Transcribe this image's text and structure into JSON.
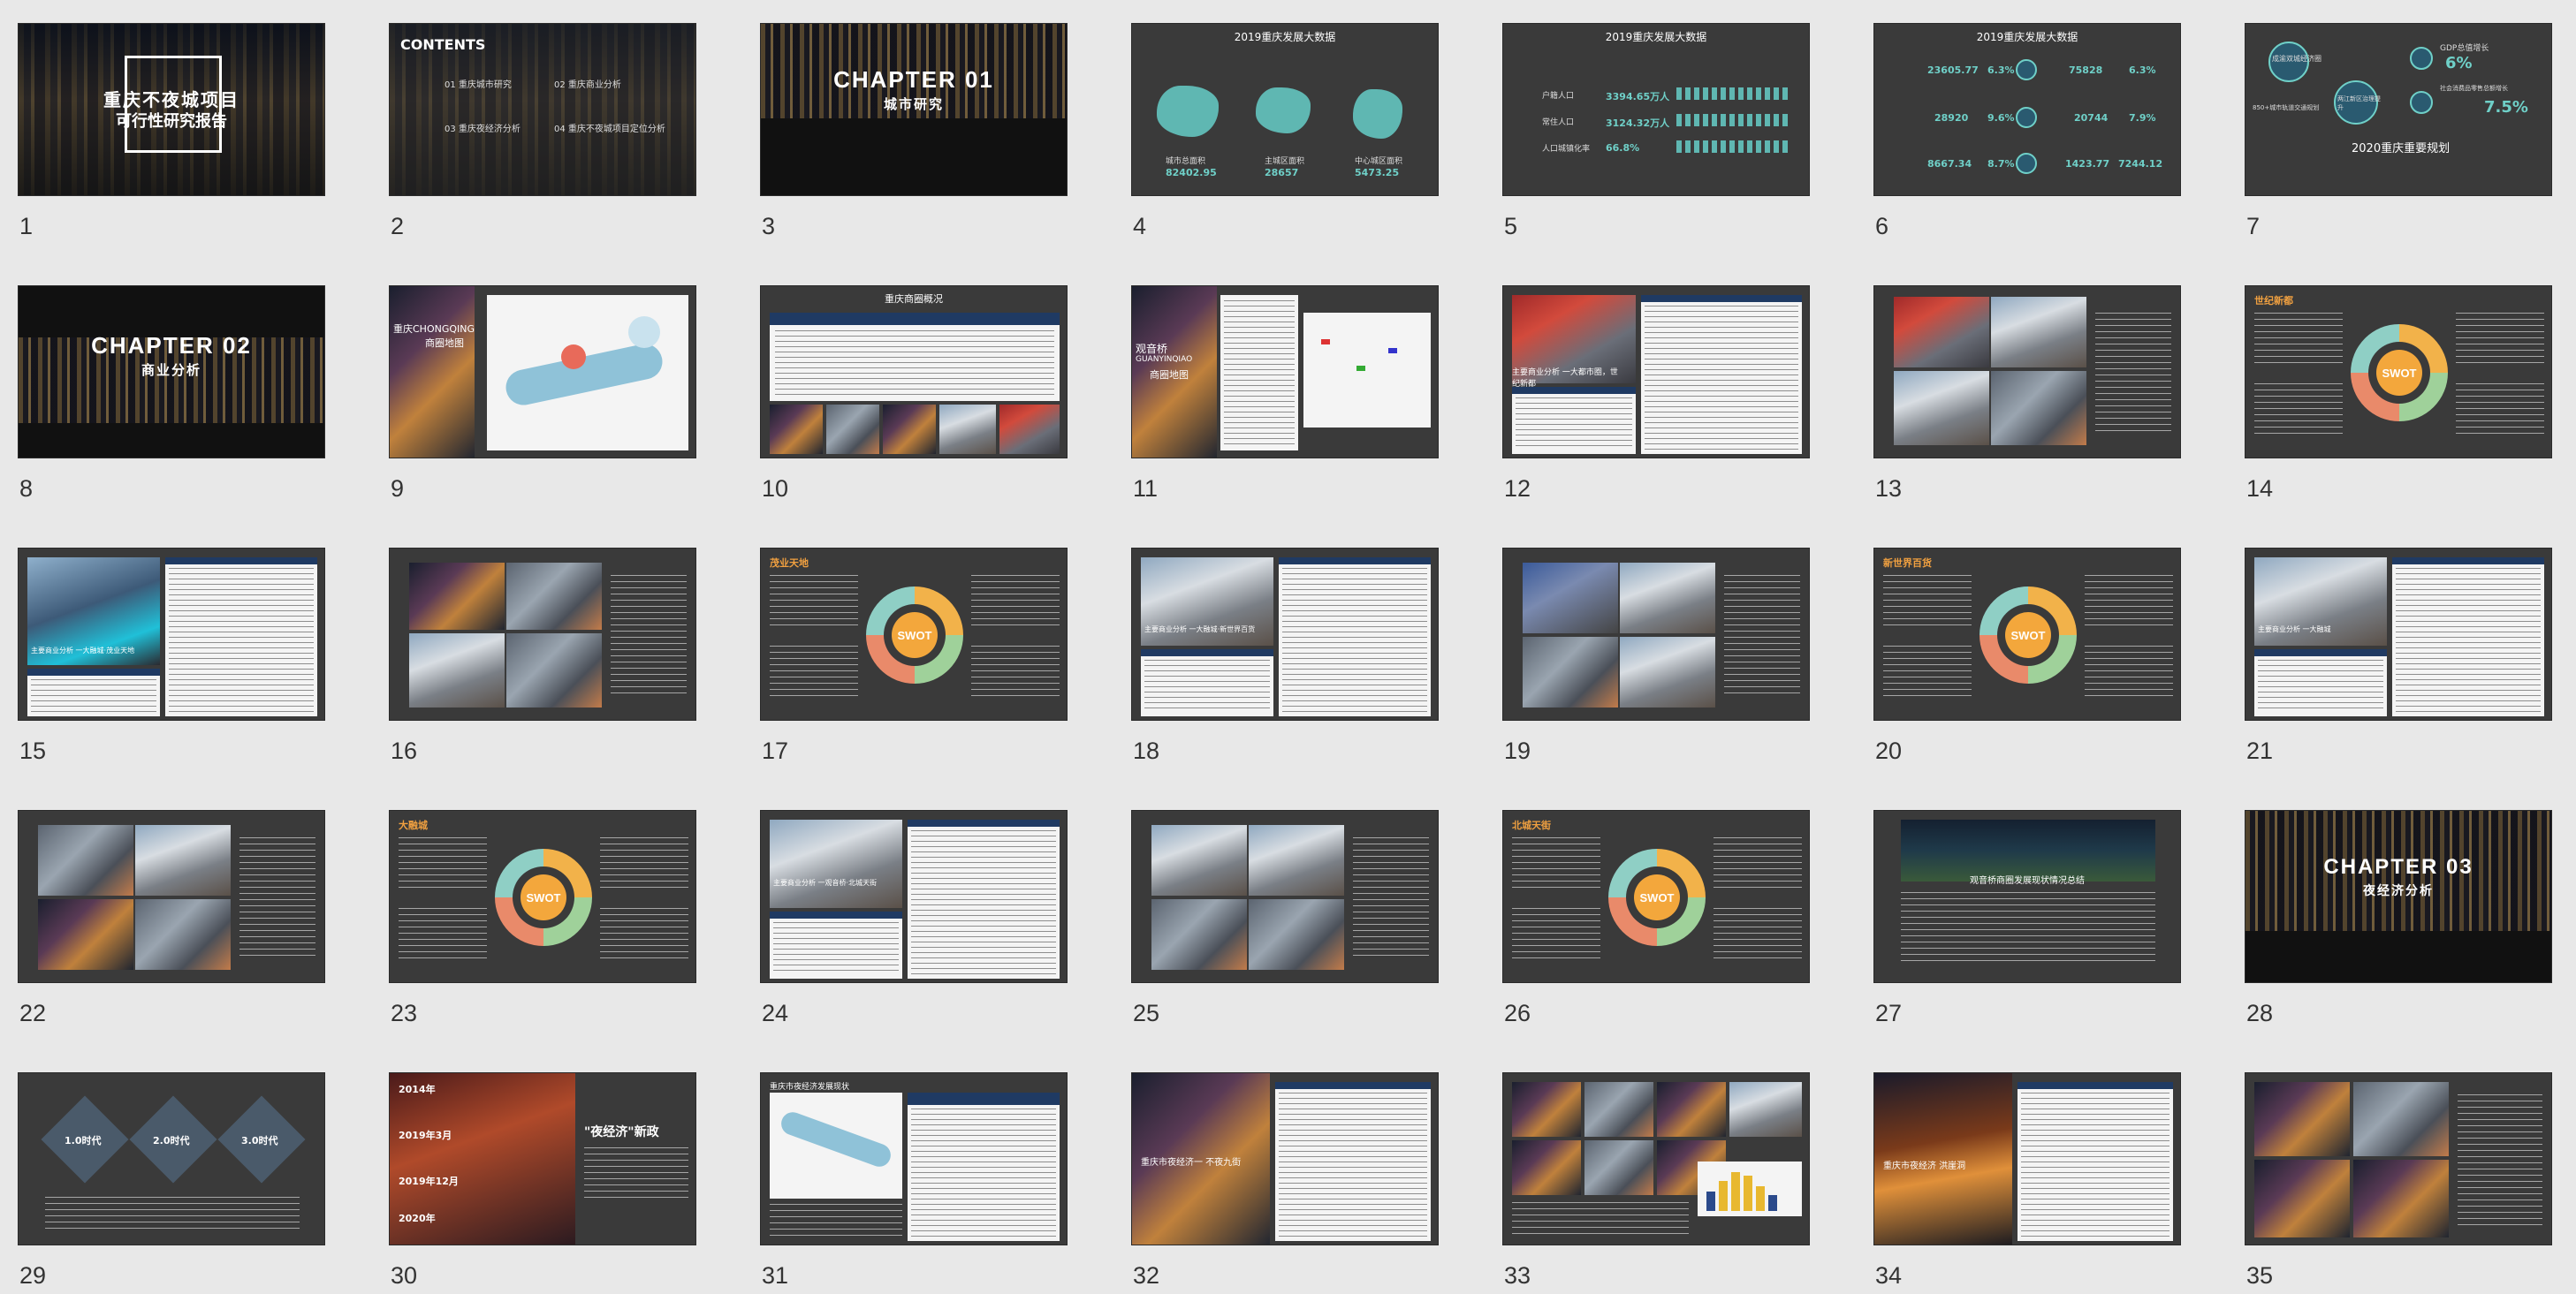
{
  "slides": [
    {
      "num": "1",
      "title": "重庆不夜城项目",
      "subtitle": "可行性研究报告"
    },
    {
      "num": "2",
      "heading": "CONTENTS",
      "items": [
        "01 重庆城市研究",
        "02 重庆商业分析",
        "03 重庆夜经济分析",
        "04 重庆不夜城项目定位分析"
      ]
    },
    {
      "num": "3",
      "title": "CHAPTER 01",
      "subtitle": "城市研究"
    },
    {
      "num": "4",
      "title": "2019重庆发展大数据",
      "labels": [
        "城市总面积",
        "主城区面积",
        "中心城区面积"
      ],
      "values": [
        "82402.95",
        "28657",
        "5473.25"
      ]
    },
    {
      "num": "5",
      "title": "2019重庆发展大数据",
      "labels": [
        "户籍人口",
        "常住人口",
        "人口城镇化率"
      ],
      "values": [
        "3394.65万人",
        "3124.32万人",
        "66.8%"
      ]
    },
    {
      "num": "6",
      "title": "2019重庆发展大数据",
      "values": [
        "23605.77",
        "6.3%",
        "75828",
        "6.3%",
        "28920",
        "9.6%",
        "20744",
        "7.9%",
        "8667.34",
        "8.7%",
        "1423.77",
        "7244.12"
      ]
    },
    {
      "num": "7",
      "title": "2020重庆重要规划",
      "labels": [
        "成渝双城经济圈",
        "GDP总值增长",
        "6%",
        "社会消费品零售总额增长",
        "7.5%",
        "两江新区治理提升",
        "850+城市轨道交通规划"
      ]
    },
    {
      "num": "8",
      "title": "CHAPTER 02",
      "subtitle": "商业分析"
    },
    {
      "num": "9",
      "title": "重庆CHONGQING",
      "subtitle": "商圈地图"
    },
    {
      "num": "10",
      "title": "重庆商圈概况"
    },
    {
      "num": "11",
      "title": "观音桥",
      "subtitle": "GUANYINQIAO",
      "caption": "商圈地图"
    },
    {
      "num": "12",
      "caption": "主要商业分析 一大都市圈，世纪新都"
    },
    {
      "num": "13"
    },
    {
      "num": "14",
      "title": "世纪新都",
      "core": "SWOT"
    },
    {
      "num": "15",
      "caption": "主要商业分析 一大融城·茂业天地"
    },
    {
      "num": "16"
    },
    {
      "num": "17",
      "title": "茂业天地",
      "core": "SWOT"
    },
    {
      "num": "18",
      "caption": "主要商业分析 一大融城·新世界百货"
    },
    {
      "num": "19"
    },
    {
      "num": "20",
      "title": "新世界百货",
      "core": "SWOT"
    },
    {
      "num": "21",
      "caption": "主要商业分析 一大融城"
    },
    {
      "num": "22"
    },
    {
      "num": "23",
      "title": "大融城",
      "core": "SWOT"
    },
    {
      "num": "24",
      "caption": "主要商业分析 一观音桥·北城天街"
    },
    {
      "num": "25"
    },
    {
      "num": "26",
      "title": "北城天街",
      "core": "SWOT"
    },
    {
      "num": "27",
      "title": "观音桥商圈发展现状情况总结"
    },
    {
      "num": "28",
      "title": "CHAPTER 03",
      "subtitle": "夜经济分析"
    },
    {
      "num": "29",
      "labels": [
        "1.0时代",
        "2.0时代",
        "3.0时代"
      ]
    },
    {
      "num": "30",
      "years": [
        "2014年",
        "2019年3月",
        "2019年12月",
        "2020年"
      ],
      "title": "\"夜经济\"新政"
    },
    {
      "num": "31",
      "title": "重庆市夜经济发展现状"
    },
    {
      "num": "32",
      "caption": "重庆市夜经济一 不夜九街"
    },
    {
      "num": "33"
    },
    {
      "num": "34",
      "caption": "重庆市夜经济 洪崖洞"
    },
    {
      "num": "35"
    }
  ]
}
